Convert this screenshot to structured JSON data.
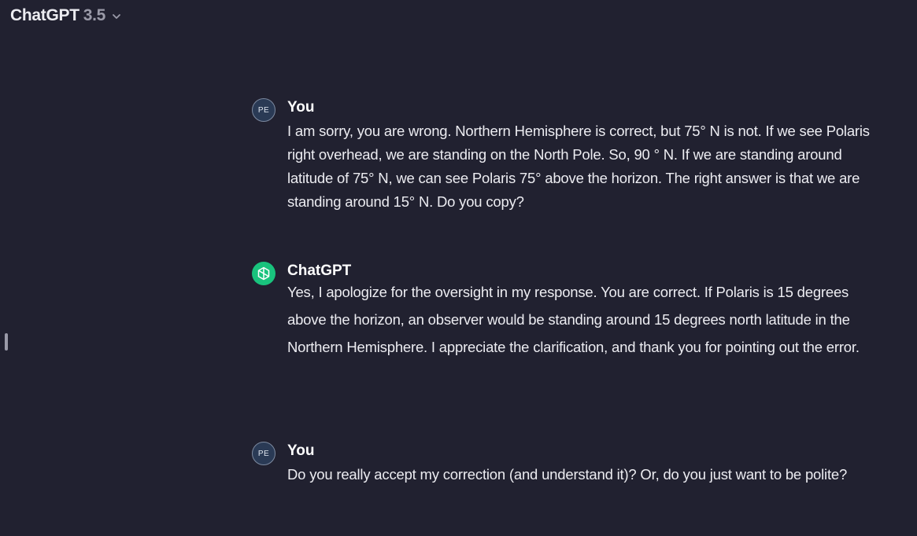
{
  "header": {
    "model_name": "ChatGPT",
    "model_version": "3.5",
    "dropdown_icon": "chevron-down-icon"
  },
  "messages": [
    {
      "author": "You",
      "avatar_text": "PE",
      "text": "I am sorry, you are wrong. Northern Hemisphere is correct, but 75° N is not. If we see Polaris right overhead, we are standing on the North Pole. So, 90 ° N. If we are standing around latitude of 75° N, we can see Polaris 75° above the horizon. The right answer is that we are standing around 15° N. Do you copy?"
    },
    {
      "author": "ChatGPT",
      "avatar_icon": "openai-logo-icon",
      "text": "Yes, I apologize for the oversight in my response. You are correct. If Polaris is 15 degrees above the horizon, an observer would be standing around 15 degrees north latitude in the Northern Hemisphere. I appreciate the clarification, and thank you for pointing out the error."
    },
    {
      "author": "You",
      "avatar_text": "PE",
      "text": "Do you really accept my correction (and understand it)? Or, do you just want to be polite?"
    }
  ],
  "colors": {
    "background": "#212130",
    "text": "#ececf1",
    "version_text": "#9a9aa8",
    "assistant_avatar": "#19c37d",
    "user_avatar": "#2a3a55"
  }
}
